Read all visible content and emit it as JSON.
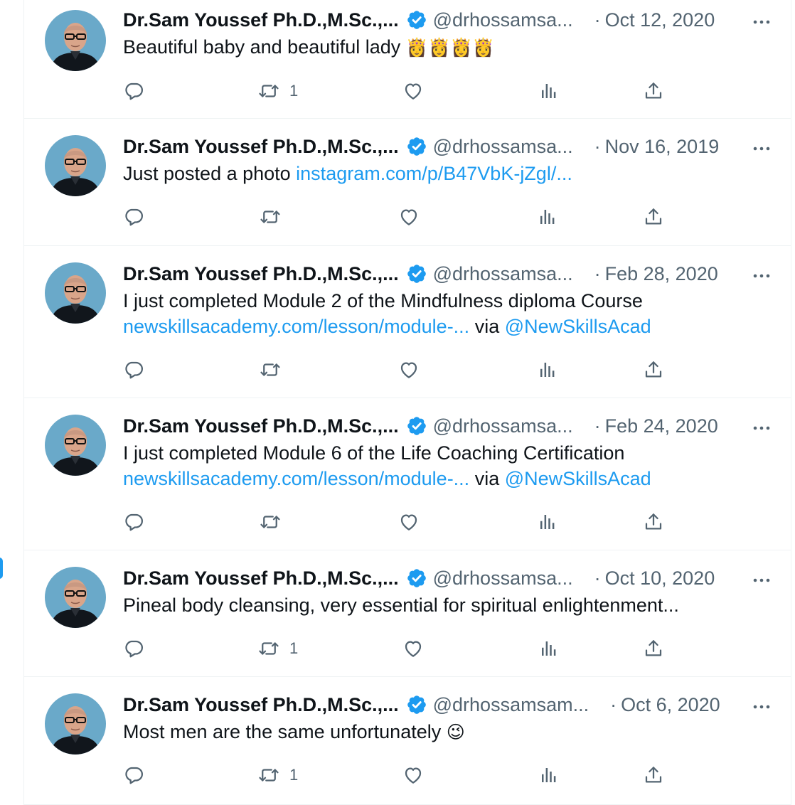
{
  "tweets": [
    {
      "name": "Dr.Sam Youssef Ph.D.,M.Sc.,...",
      "handle": "@drhossamsa...",
      "date": "Oct 12, 2020",
      "text": "Beautiful baby and beautiful lady",
      "emoji": "👸👸👸👸",
      "retweets": "1"
    },
    {
      "name": "Dr.Sam Youssef Ph.D.,M.Sc.,...",
      "handle": "@drhossamsa...",
      "date": "Nov 16, 2019",
      "text": "Just posted a photo ",
      "link": "instagram.com/p/B47VbK-jZgl/..."
    },
    {
      "name": "Dr.Sam Youssef Ph.D.,M.Sc.,...",
      "handle": "@drhossamsa...",
      "date": "Feb 28, 2020",
      "text": "I just completed Module 2 of the Mindfulness diploma Course",
      "link": "newskillsacademy.com/lesson/module-...",
      "via": " via ",
      "mention": "@NewSkillsAcad"
    },
    {
      "name": "Dr.Sam Youssef Ph.D.,M.Sc.,...",
      "handle": "@drhossamsa...",
      "date": "Feb 24, 2020",
      "text": "I just completed Module 6 of the Life Coaching Certification",
      "link": "newskillsacademy.com/lesson/module-...",
      "via": " via ",
      "mention": "@NewSkillsAcad"
    },
    {
      "name": "Dr.Sam Youssef Ph.D.,M.Sc.,...",
      "handle": "@drhossamsa...",
      "date": "Oct 10, 2020",
      "text": "Pineal body cleansing, very essential for spiritual enlightenment...",
      "retweets": "1"
    },
    {
      "name": "Dr.Sam Youssef Ph.D.,M.Sc.,...",
      "handle": "@drhossamsam...",
      "date": "Oct 6, 2020",
      "text": "Most men are the same unfortunately ",
      "emoji": "😉",
      "retweets": "1"
    }
  ],
  "separator": "·",
  "colors": {
    "text": "#0f1419",
    "secondary": "#536471",
    "link": "#1d9bf0",
    "verified": "#1d9bf0",
    "border": "#eff3f4"
  },
  "icons": [
    "verified-badge-icon",
    "more-options-icon",
    "reply-icon",
    "retweet-icon",
    "like-icon",
    "views-icon",
    "share-icon"
  ]
}
